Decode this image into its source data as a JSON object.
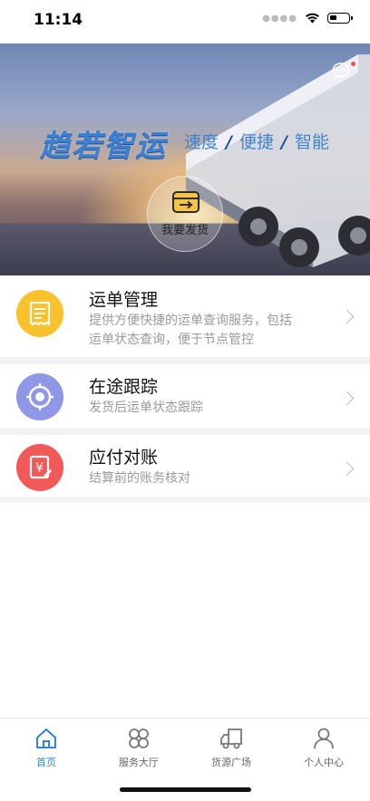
{
  "status": {
    "time": "11:14"
  },
  "banner": {
    "title": "趋若智运",
    "slogan": [
      "速度",
      "便捷",
      "智能"
    ],
    "ship_label": "我要发货",
    "icons": {
      "message": "message-icon",
      "ship": "ship-icon"
    }
  },
  "menu": [
    {
      "title": "运单管理",
      "desc_line1": "提供方便快捷的运单查询服务，包括",
      "desc_line2": "运单状态查询，便于节点管控",
      "color": "#f9c12c",
      "icon": "receipt-icon"
    },
    {
      "title": "在途跟踪",
      "desc_line1": "发货后运单状态跟踪",
      "color": "#8e98e6",
      "icon": "locate-icon"
    },
    {
      "title": "应付对账",
      "desc_line1": "结算前的账务核对",
      "color": "#f25a5a",
      "icon": "bill-edit-icon"
    }
  ],
  "tabs": [
    {
      "label": "首页",
      "icon": "home-icon",
      "active": true
    },
    {
      "label": "服务大厅",
      "icon": "grid-icon"
    },
    {
      "label": "货源广场",
      "icon": "truck-icon"
    },
    {
      "label": "个人中心",
      "icon": "person-icon"
    }
  ],
  "colors": {
    "accent": "#2f86e0"
  }
}
